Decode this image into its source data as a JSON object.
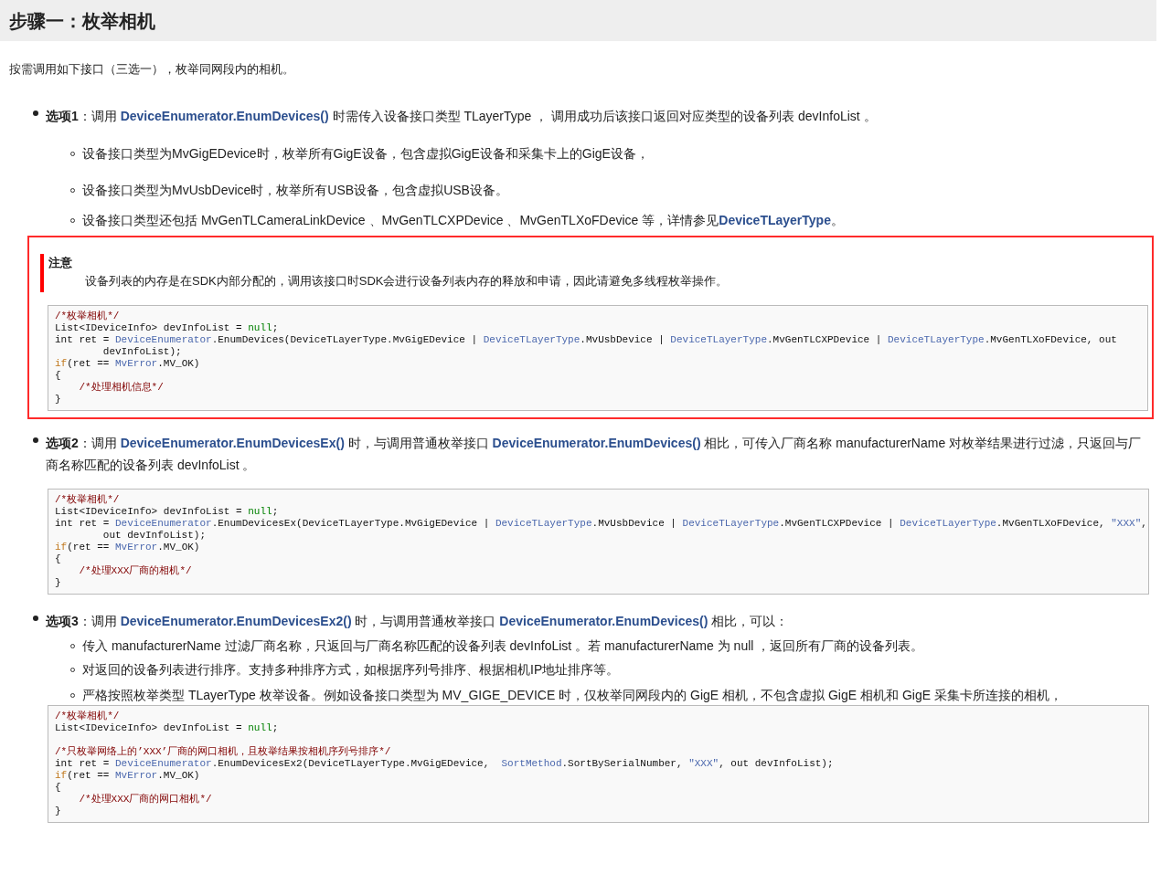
{
  "heading": "步骤一：枚举相机",
  "intro": "按需调用如下接口（三选一），枚举同网段内的相机。",
  "blocks": [
    {
      "kind": "bullet",
      "segments": [
        {
          "kind": "bold",
          "text": "选项1"
        },
        {
          "kind": "text",
          "text": "：调用 "
        },
        {
          "kind": "link",
          "text": "DeviceEnumerator.EnumDevices()"
        },
        {
          "kind": "text",
          "text": " 时需传入设备接口类型 TLayerType ， 调用成功后该接口返回对应类型的设备列表 devInfoList 。"
        }
      ]
    },
    {
      "kind": "subbullet",
      "segments": [
        {
          "kind": "text",
          "text": "设备接口类型为MvGigEDevice时，枚举所有GigE设备，包含虚拟GigE设备和采集卡上的GigE设备，"
        }
      ]
    },
    {
      "kind": "subbullet",
      "segments": [
        {
          "kind": "text",
          "text": "设备接口类型为MvUsbDevice时，枚举所有USB设备，包含虚拟USB设备。"
        }
      ]
    },
    {
      "kind": "subbullet",
      "segments": [
        {
          "kind": "text",
          "text": "设备接口类型还包括 MvGenTLCameraLinkDevice 、MvGenTLCXPDevice 、MvGenTLXoFDevice 等，详情参见"
        },
        {
          "kind": "link",
          "text": "DeviceTLayerType"
        },
        {
          "kind": "text",
          "text": "。"
        }
      ]
    },
    {
      "kind": "note",
      "title": "注意",
      "text": "设备列表的内存是在SDK内部分配的，调用该接口时SDK会进行设备列表内存的释放和申请，因此请避免多线程枚举操作。",
      "code": [
        [
          {
            "kind": "comment",
            "text": "/*枚举相机*/"
          }
        ],
        [
          {
            "kind": "plain",
            "text": "List<IDeviceInfo> devInfoList = "
          },
          {
            "kind": "literal",
            "text": "null"
          },
          {
            "kind": "plain",
            "text": ";"
          }
        ],
        [
          {
            "kind": "plain",
            "text": "int ret = "
          },
          {
            "kind": "type",
            "text": "DeviceEnumerator"
          },
          {
            "kind": "plain",
            "text": ".EnumDevices(DeviceTLayerType.MvGigEDevice | "
          },
          {
            "kind": "type",
            "text": "DeviceTLayerType"
          },
          {
            "kind": "plain",
            "text": ".MvUsbDevice | "
          },
          {
            "kind": "type",
            "text": "DeviceTLayerType"
          },
          {
            "kind": "plain",
            "text": ".MvGenTLCXPDevice | "
          },
          {
            "kind": "type",
            "text": "DeviceTLayerType"
          },
          {
            "kind": "plain",
            "text": ".MvGenTLXoFDevice, out"
          }
        ],
        [
          {
            "kind": "plain",
            "text": "        devInfoList);"
          }
        ],
        [
          {
            "kind": "keyword",
            "text": "if"
          },
          {
            "kind": "plain",
            "text": "(ret == "
          },
          {
            "kind": "type",
            "text": "MvError"
          },
          {
            "kind": "plain",
            "text": ".MV_OK)"
          }
        ],
        [
          {
            "kind": "plain",
            "text": "{"
          }
        ],
        [
          {
            "kind": "comment",
            "text": "    /*处理相机信息*/"
          }
        ],
        [
          {
            "kind": "plain",
            "text": "}"
          }
        ]
      ]
    },
    {
      "kind": "bullet",
      "segments": [
        {
          "kind": "bold",
          "text": "选项2"
        },
        {
          "kind": "text",
          "text": "：调用 "
        },
        {
          "kind": "link",
          "text": "DeviceEnumerator.EnumDevicesEx()"
        },
        {
          "kind": "text",
          "text": " 时，与调用普通枚举接口 "
        },
        {
          "kind": "link",
          "text": "DeviceEnumerator.EnumDevices()"
        },
        {
          "kind": "text",
          "text": " 相比，可传入厂商名称 manufacturerName 对枚举结果进行过滤，只返回与厂商名称匹配的设备列表 devInfoList 。"
        }
      ]
    },
    {
      "kind": "code",
      "code": [
        [
          {
            "kind": "comment",
            "text": "/*枚举相机*/"
          }
        ],
        [
          {
            "kind": "plain",
            "text": "List<IDeviceInfo> devInfoList = "
          },
          {
            "kind": "literal",
            "text": "null"
          },
          {
            "kind": "plain",
            "text": ";"
          }
        ],
        [
          {
            "kind": "plain",
            "text": "int ret = "
          },
          {
            "kind": "type",
            "text": "DeviceEnumerator"
          },
          {
            "kind": "plain",
            "text": ".EnumDevicesEx(DeviceTLayerType.MvGigEDevice | "
          },
          {
            "kind": "type",
            "text": "DeviceTLayerType"
          },
          {
            "kind": "plain",
            "text": ".MvUsbDevice | "
          },
          {
            "kind": "type",
            "text": "DeviceTLayerType"
          },
          {
            "kind": "plain",
            "text": ".MvGenTLCXPDevice | "
          },
          {
            "kind": "type",
            "text": "DeviceTLayerType"
          },
          {
            "kind": "plain",
            "text": ".MvGenTLXoFDevice, "
          },
          {
            "kind": "string",
            "text": "\"XXX\""
          },
          {
            "kind": "plain",
            "text": ","
          }
        ],
        [
          {
            "kind": "plain",
            "text": "        out devInfoList);"
          }
        ],
        [
          {
            "kind": "keyword",
            "text": "if"
          },
          {
            "kind": "plain",
            "text": "(ret == "
          },
          {
            "kind": "type",
            "text": "MvError"
          },
          {
            "kind": "plain",
            "text": ".MV_OK)"
          }
        ],
        [
          {
            "kind": "plain",
            "text": "{"
          }
        ],
        [
          {
            "kind": "comment",
            "text": "    /*处理XXX厂商的相机*/"
          }
        ],
        [
          {
            "kind": "plain",
            "text": "}"
          }
        ]
      ]
    },
    {
      "kind": "bullet",
      "segments": [
        {
          "kind": "bold",
          "text": "选项3"
        },
        {
          "kind": "text",
          "text": "：调用 "
        },
        {
          "kind": "link",
          "text": "DeviceEnumerator.EnumDevicesEx2()"
        },
        {
          "kind": "text",
          "text": " 时，与调用普通枚举接口 "
        },
        {
          "kind": "link",
          "text": "DeviceEnumerator.EnumDevices()"
        },
        {
          "kind": "text",
          "text": " 相比，可以："
        }
      ]
    },
    {
      "kind": "subbullet",
      "segments": [
        {
          "kind": "text",
          "text": "传入 manufacturerName 过滤厂商名称，只返回与厂商名称匹配的设备列表 devInfoList 。若 manufacturerName 为 null ，返回所有厂商的设备列表。"
        }
      ]
    },
    {
      "kind": "subbullet",
      "segments": [
        {
          "kind": "text",
          "text": "对返回的设备列表进行排序。支持多种排序方式，如根据序列号排序、根据相机IP地址排序等。"
        }
      ]
    },
    {
      "kind": "subbullet",
      "segments": [
        {
          "kind": "text",
          "text": "严格按照枚举类型 TLayerType 枚举设备。例如设备接口类型为 MV_GIGE_DEVICE 时，仅枚举同网段内的 GigE 相机，不包含虚拟 GigE 相机和 GigE 采集卡所连接的相机，"
        }
      ]
    },
    {
      "kind": "code",
      "code": [
        [
          {
            "kind": "comment",
            "text": "/*枚举相机*/"
          }
        ],
        [
          {
            "kind": "plain",
            "text": "List<IDeviceInfo> devInfoList = "
          },
          {
            "kind": "literal",
            "text": "null"
          },
          {
            "kind": "plain",
            "text": ";"
          }
        ],
        [
          {
            "kind": "blank"
          }
        ],
        [
          {
            "kind": "comment",
            "text": "/*只枚举网络上的’XXX’厂商的网口相机，且枚举结果按相机序列号排序*/"
          }
        ],
        [
          {
            "kind": "plain",
            "text": "int ret = "
          },
          {
            "kind": "type",
            "text": "DeviceEnumerator"
          },
          {
            "kind": "plain",
            "text": ".EnumDevicesEx2(DeviceTLayerType.MvGigEDevice,  "
          },
          {
            "kind": "type",
            "text": "SortMethod"
          },
          {
            "kind": "plain",
            "text": ".SortBySerialNumber, "
          },
          {
            "kind": "string",
            "text": "\"XXX\""
          },
          {
            "kind": "plain",
            "text": ", out devInfoList);"
          }
        ],
        [
          {
            "kind": "keyword",
            "text": "if"
          },
          {
            "kind": "plain",
            "text": "(ret == "
          },
          {
            "kind": "type",
            "text": "MvError"
          },
          {
            "kind": "plain",
            "text": ".MV_OK)"
          }
        ],
        [
          {
            "kind": "plain",
            "text": "{"
          }
        ],
        [
          {
            "kind": "comment",
            "text": "    /*处理XXX厂商的网口相机*/"
          }
        ],
        [
          {
            "kind": "plain",
            "text": "}"
          }
        ]
      ]
    }
  ]
}
